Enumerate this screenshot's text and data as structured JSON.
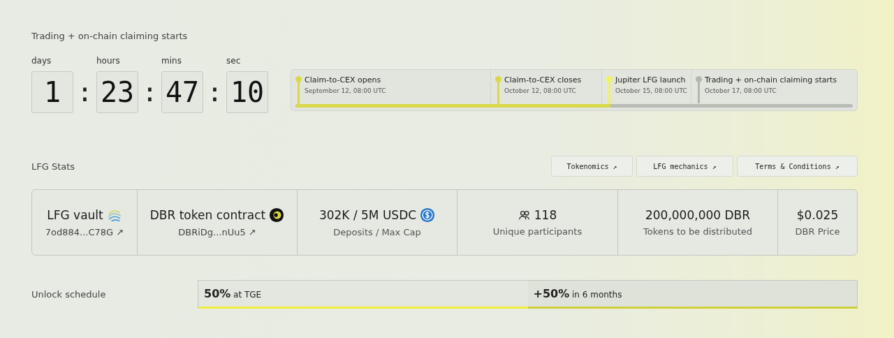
{
  "countdown": {
    "title": "Trading + on-chain claiming starts",
    "units": [
      {
        "label": "days",
        "value": "1"
      },
      {
        "label": "hours",
        "value": "23"
      },
      {
        "label": "mins",
        "value": "47"
      },
      {
        "label": "sec",
        "value": "10"
      }
    ],
    "separator": ":"
  },
  "timeline": {
    "level": 0.565,
    "milestones": [
      {
        "title": "Claim-to-CEX opens",
        "date": "September 12, 08:00 UTC",
        "reached": true,
        "active": false
      },
      {
        "title": "Claim-to-CEX closes",
        "date": "October 12, 08:00 UTC",
        "reached": true,
        "active": false
      },
      {
        "title": "Jupiter LFG launch",
        "date": "October 15, 08:00 UTC",
        "reached": true,
        "active": true
      },
      {
        "title": "Trading + on-chain claiming starts",
        "date": "October 17, 08:00 UTC",
        "reached": false,
        "active": false
      }
    ]
  },
  "stats": {
    "title": "LFG Stats",
    "links": [
      {
        "label": "Tokenomics",
        "arrow": "↗"
      },
      {
        "label": "LFG mechanics",
        "arrow": "↗"
      },
      {
        "label": "Terms & Conditions",
        "arrow": "↗"
      }
    ],
    "cells": [
      {
        "value": "LFG vault",
        "kind": "waves",
        "sub": "7od884...C78G",
        "arrow": "↗"
      },
      {
        "value": "DBR token contract",
        "kind": "coin",
        "sub": "DBRiDg...nUu5",
        "arrow": "↗"
      },
      {
        "value": "302K / 5M USDC",
        "kind": "usdc",
        "sub": "Deposits / Max Cap"
      },
      {
        "value": "118",
        "kind": "people",
        "sub": "Unique participants"
      },
      {
        "value": "200,000,000 DBR",
        "sub": "Tokens to be distributed"
      },
      {
        "value": "$0.025",
        "sub": "DBR Price"
      }
    ]
  },
  "unlock": {
    "title": "Unlock schedule",
    "segments": [
      {
        "amount": "50%",
        "text": "at TGE",
        "color": "#f0f03c"
      },
      {
        "amount": "+50%",
        "text": "in 6 months",
        "color": "#cfcf3a"
      }
    ]
  }
}
